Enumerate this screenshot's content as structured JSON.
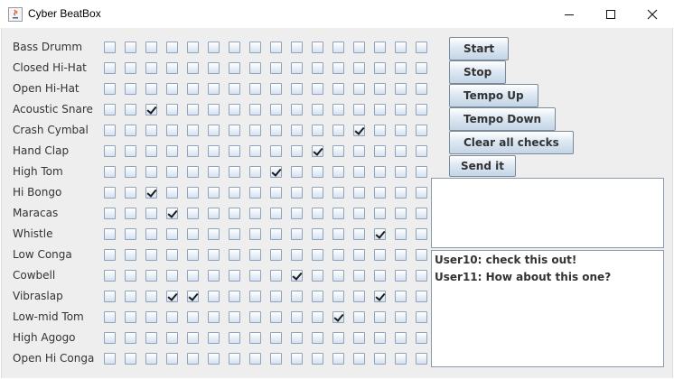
{
  "window": {
    "title": "Cyber BeatBox"
  },
  "instruments": [
    "Bass Drumm",
    "Closed Hi-Hat",
    "Open Hi-Hat",
    "Acoustic Snare",
    "Crash Cymbal",
    "Hand Clap",
    "High Tom",
    "Hi Bongo",
    "Maracas",
    "Whistle",
    "Low Conga",
    "Cowbell",
    "Vibraslap",
    "Low-mid Tom",
    "High Agogo",
    "Open Hi Conga"
  ],
  "checked": [
    [
      3,
      2
    ],
    [
      4,
      12
    ],
    [
      5,
      10
    ],
    [
      6,
      8
    ],
    [
      7,
      2
    ],
    [
      8,
      3
    ],
    [
      9,
      13
    ],
    [
      11,
      9
    ],
    [
      12,
      3
    ],
    [
      12,
      4
    ],
    [
      12,
      13
    ],
    [
      13,
      11
    ]
  ],
  "buttons": {
    "start": "Start",
    "stop": "Stop",
    "tempo_up": "Tempo Up",
    "tempo_down": "Tempo Down",
    "clear": "Clear all checks",
    "send": "Send it"
  },
  "message_input": {
    "value": ""
  },
  "incoming": [
    "User10: check this out!",
    "User11: How about this one?"
  ]
}
